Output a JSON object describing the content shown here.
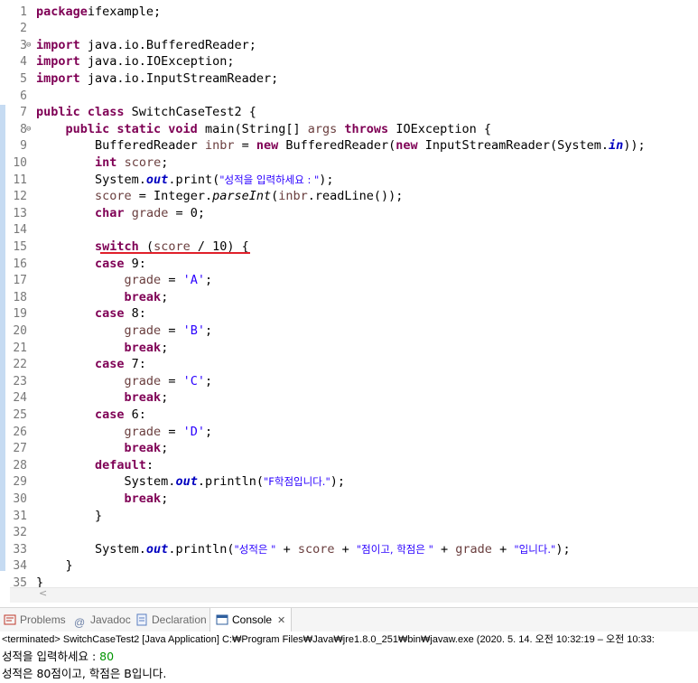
{
  "editor": {
    "lines": [
      {
        "n": "1",
        "fold": "",
        "segs": [
          [
            "kw",
            "package"
          ],
          [
            "",
            "ifexample;"
          ]
        ]
      },
      {
        "n": "2",
        "fold": "",
        "segs": []
      },
      {
        "n": "3",
        "fold": "⊖",
        "segs": [
          [
            "kw",
            "import"
          ],
          [
            "",
            " java.io.BufferedReader;"
          ]
        ]
      },
      {
        "n": "4",
        "fold": "",
        "segs": [
          [
            "kw",
            "import"
          ],
          [
            "",
            " java.io.IOException;"
          ]
        ]
      },
      {
        "n": "5",
        "fold": "",
        "segs": [
          [
            "kw",
            "import"
          ],
          [
            "",
            " java.io.InputStreamReader;"
          ]
        ]
      },
      {
        "n": "6",
        "fold": "",
        "segs": []
      },
      {
        "n": "7",
        "fold": "",
        "segs": [
          [
            "kw",
            "public class"
          ],
          [
            "",
            " SwitchCaseTest2 {"
          ]
        ]
      },
      {
        "n": "8",
        "fold": "⊖",
        "segs": [
          [
            "",
            "    "
          ],
          [
            "kw",
            "public static void"
          ],
          [
            "",
            " main(String[] "
          ],
          [
            "varx",
            "args"
          ],
          [
            "",
            " "
          ],
          [
            "kw",
            "throws"
          ],
          [
            "",
            " IOException {"
          ]
        ]
      },
      {
        "n": "9",
        "fold": "",
        "segs": [
          [
            "",
            "        BufferedReader "
          ],
          [
            "varx",
            "inbr"
          ],
          [
            "",
            " = "
          ],
          [
            "kw",
            "new"
          ],
          [
            "",
            " BufferedReader("
          ],
          [
            "kw",
            "new"
          ],
          [
            "",
            " InputStreamReader(System."
          ],
          [
            "fld",
            "in"
          ],
          [
            "",
            "));"
          ]
        ]
      },
      {
        "n": "10",
        "fold": "",
        "segs": [
          [
            "",
            "        "
          ],
          [
            "kw",
            "int"
          ],
          [
            "",
            " "
          ],
          [
            "varx",
            "score"
          ],
          [
            "",
            ";"
          ]
        ]
      },
      {
        "n": "11",
        "fold": "",
        "segs": [
          [
            "",
            "        System."
          ],
          [
            "fld",
            "out"
          ],
          [
            "",
            ".print("
          ],
          [
            "str kor",
            "\"성적을 입력하세요 : \""
          ],
          [
            "",
            ");"
          ]
        ]
      },
      {
        "n": "12",
        "fold": "",
        "segs": [
          [
            "",
            "        "
          ],
          [
            "varx",
            "score"
          ],
          [
            "",
            " = Integer."
          ],
          [
            "sm",
            "parseInt"
          ],
          [
            "",
            "("
          ],
          [
            "varx",
            "inbr"
          ],
          [
            "",
            ".readLine());"
          ]
        ]
      },
      {
        "n": "13",
        "fold": "",
        "segs": [
          [
            "",
            "        "
          ],
          [
            "kw",
            "char"
          ],
          [
            "",
            " "
          ],
          [
            "varx",
            "grade"
          ],
          [
            "",
            " = 0;"
          ]
        ]
      },
      {
        "n": "14",
        "fold": "",
        "segs": []
      },
      {
        "n": "15",
        "fold": "",
        "segs": [
          [
            "",
            "        "
          ],
          [
            "kw",
            "switch"
          ],
          [
            "",
            " ("
          ],
          [
            "varx",
            "score"
          ],
          [
            "",
            " / 10) {"
          ]
        ]
      },
      {
        "n": "16",
        "fold": "",
        "segs": [
          [
            "",
            "        "
          ],
          [
            "kw",
            "case"
          ],
          [
            "",
            " 9:"
          ]
        ]
      },
      {
        "n": "17",
        "fold": "",
        "segs": [
          [
            "",
            "            "
          ],
          [
            "varx",
            "grade"
          ],
          [
            "",
            " = "
          ],
          [
            "str",
            "'A'"
          ],
          [
            "",
            ";"
          ]
        ]
      },
      {
        "n": "18",
        "fold": "",
        "segs": [
          [
            "",
            "            "
          ],
          [
            "kw",
            "break"
          ],
          [
            "",
            ";"
          ]
        ]
      },
      {
        "n": "19",
        "fold": "",
        "segs": [
          [
            "",
            "        "
          ],
          [
            "kw",
            "case"
          ],
          [
            "",
            " 8:"
          ]
        ]
      },
      {
        "n": "20",
        "fold": "",
        "segs": [
          [
            "",
            "            "
          ],
          [
            "varx",
            "grade"
          ],
          [
            "",
            " = "
          ],
          [
            "str",
            "'B'"
          ],
          [
            "",
            ";"
          ]
        ]
      },
      {
        "n": "21",
        "fold": "",
        "segs": [
          [
            "",
            "            "
          ],
          [
            "kw",
            "break"
          ],
          [
            "",
            ";"
          ]
        ]
      },
      {
        "n": "22",
        "fold": "",
        "segs": [
          [
            "",
            "        "
          ],
          [
            "kw",
            "case"
          ],
          [
            "",
            " 7:"
          ]
        ]
      },
      {
        "n": "23",
        "fold": "",
        "segs": [
          [
            "",
            "            "
          ],
          [
            "varx",
            "grade"
          ],
          [
            "",
            " = "
          ],
          [
            "str",
            "'C'"
          ],
          [
            "",
            ";"
          ]
        ]
      },
      {
        "n": "24",
        "fold": "",
        "segs": [
          [
            "",
            "            "
          ],
          [
            "kw",
            "break"
          ],
          [
            "",
            ";"
          ]
        ]
      },
      {
        "n": "25",
        "fold": "",
        "segs": [
          [
            "",
            "        "
          ],
          [
            "kw",
            "case"
          ],
          [
            "",
            " 6:"
          ]
        ]
      },
      {
        "n": "26",
        "fold": "",
        "segs": [
          [
            "",
            "            "
          ],
          [
            "varx",
            "grade"
          ],
          [
            "",
            " = "
          ],
          [
            "str",
            "'D'"
          ],
          [
            "",
            ";"
          ]
        ]
      },
      {
        "n": "27",
        "fold": "",
        "segs": [
          [
            "",
            "            "
          ],
          [
            "kw",
            "break"
          ],
          [
            "",
            ";"
          ]
        ]
      },
      {
        "n": "28",
        "fold": "",
        "segs": [
          [
            "",
            "        "
          ],
          [
            "kw",
            "default"
          ],
          [
            "",
            ":"
          ]
        ]
      },
      {
        "n": "29",
        "fold": "",
        "segs": [
          [
            "",
            "            System."
          ],
          [
            "fld",
            "out"
          ],
          [
            "",
            ".println("
          ],
          [
            "str kor",
            "\"F학점입니다.\""
          ],
          [
            "",
            ");"
          ]
        ]
      },
      {
        "n": "30",
        "fold": "",
        "segs": [
          [
            "",
            "            "
          ],
          [
            "kw",
            "break"
          ],
          [
            "",
            ";"
          ]
        ]
      },
      {
        "n": "31",
        "fold": "",
        "segs": [
          [
            "",
            "        }"
          ]
        ]
      },
      {
        "n": "32",
        "fold": "",
        "segs": []
      },
      {
        "n": "33",
        "fold": "",
        "segs": [
          [
            "",
            "        System."
          ],
          [
            "fld",
            "out"
          ],
          [
            "",
            ".println("
          ],
          [
            "str kor",
            "\"성적은 \""
          ],
          [
            "",
            " + "
          ],
          [
            "varx",
            "score"
          ],
          [
            "",
            " + "
          ],
          [
            "str kor",
            "\"점이고, 학점은 \""
          ],
          [
            "",
            " + "
          ],
          [
            "varx",
            "grade"
          ],
          [
            "",
            " + "
          ],
          [
            "str kor",
            "\"입니다.\""
          ],
          [
            "",
            ");"
          ]
        ]
      },
      {
        "n": "34",
        "fold": "",
        "segs": [
          [
            "",
            "    }"
          ]
        ]
      },
      {
        "n": "35",
        "fold": "",
        "segs": [
          [
            "",
            "}"
          ]
        ]
      }
    ],
    "scroll_left_glyph": "<"
  },
  "views": {
    "tabs": [
      {
        "label": "Problems",
        "icon": "problems-icon",
        "color": "#c0392b"
      },
      {
        "label": "Javadoc",
        "icon": "at-icon",
        "color": "#6b7fa6"
      },
      {
        "label": "Declaration",
        "icon": "declaration-icon",
        "color": "#5a7ec0"
      },
      {
        "label": "Console",
        "icon": "console-icon",
        "color": "#2f5f9e"
      }
    ],
    "close_glyph": "✕"
  },
  "console": {
    "status": "<terminated> SwitchCaseTest2 [Java Application] C:₩Program Files₩Java₩jre1.8.0_251₩bin₩javaw.exe  (2020. 5. 14. 오전 10:32:19 – 오전 10:33:",
    "prompt": "성적을 입력하세요 : ",
    "input": "80",
    "result": "성적은 80점이고, 학점은 B입니다."
  },
  "colors": {
    "keyword": "#7f0055",
    "string": "#2a00ff",
    "field": "#0000c0",
    "input": "#009400",
    "annotation": "#e0202a"
  }
}
